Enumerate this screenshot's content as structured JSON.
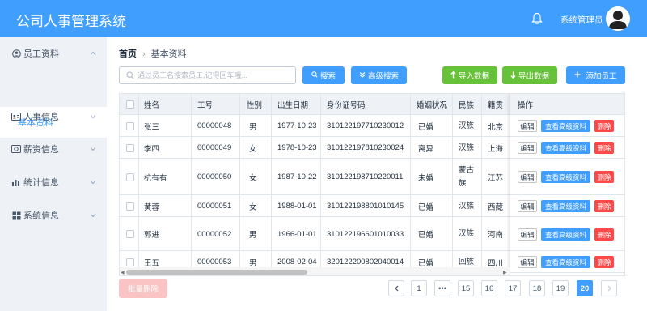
{
  "header": {
    "title": "公司人事管理系统",
    "user_name": "系统管理员"
  },
  "sidebar": {
    "menus": [
      {
        "label": "员工资料",
        "icon": "user-circle-icon"
      },
      {
        "label": "人事信息",
        "icon": "id-card-icon"
      },
      {
        "label": "薪资信息",
        "icon": "money-icon"
      },
      {
        "label": "统计信息",
        "icon": "bar-chart-icon"
      },
      {
        "label": "系统信息",
        "icon": "windows-icon"
      }
    ],
    "active_submenu": "基本资料"
  },
  "breadcrumb": {
    "home": "首页",
    "current": "基本资料"
  },
  "toolbar": {
    "search_placeholder": "通过员工名搜索员工,记得回车哦...",
    "search_label": "搜索",
    "advanced_search_label": "高级搜索",
    "import_label": "导入数据",
    "export_label": "导出数据",
    "add_label": "添加员工"
  },
  "table": {
    "columns": [
      "姓名",
      "工号",
      "性别",
      "出生日期",
      "身份证号码",
      "婚姻状况",
      "民族",
      "籍贯",
      "操作"
    ],
    "rows": [
      {
        "name": "张三",
        "id": "00000048",
        "gender": "男",
        "birth": "1977-10-23",
        "idcard": "310122197710230012",
        "marital": "已婚",
        "nation": "汉族",
        "native": "北京"
      },
      {
        "name": "李四",
        "id": "00000049",
        "gender": "女",
        "birth": "1978-10-23",
        "idcard": "310122197810230024",
        "marital": "离异",
        "nation": "汉族",
        "native": "上海"
      },
      {
        "name": "杭有有",
        "id": "00000050",
        "gender": "女",
        "birth": "1987-10-22",
        "idcard": "310122198710220011",
        "marital": "未婚",
        "nation": "蒙古族",
        "native": "江苏"
      },
      {
        "name": "黄蓉",
        "id": "00000051",
        "gender": "女",
        "birth": "1988-01-01",
        "idcard": "310122198801010145",
        "marital": "已婚",
        "nation": "汉族",
        "native": "西藏"
      },
      {
        "name": "郭进",
        "id": "00000052",
        "gender": "男",
        "birth": "1966-01-01",
        "idcard": "310122196601010033",
        "marital": "已婚",
        "nation": "汉族",
        "native": "河南"
      },
      {
        "name": "王五",
        "id": "00000053",
        "gender": "男",
        "birth": "2008-02-04",
        "idcard": "320122200802040014",
        "marital": "已婚",
        "nation": "回族",
        "native": "四川"
      }
    ],
    "op_edit": "编辑",
    "op_view": "查看高级资料",
    "op_delete": "删除"
  },
  "footer": {
    "batch_delete_label": "批量删除",
    "pages": [
      "1",
      "•••",
      "15",
      "16",
      "17",
      "18",
      "19",
      "20"
    ],
    "current_page": "20",
    "prev_icon": "chevron-left-icon",
    "next_icon": "chevron-right-icon"
  },
  "colors": {
    "primary": "#409eff",
    "success": "#67c23a",
    "danger": "#ff4949",
    "sidebar_bg": "#eef1f6"
  }
}
